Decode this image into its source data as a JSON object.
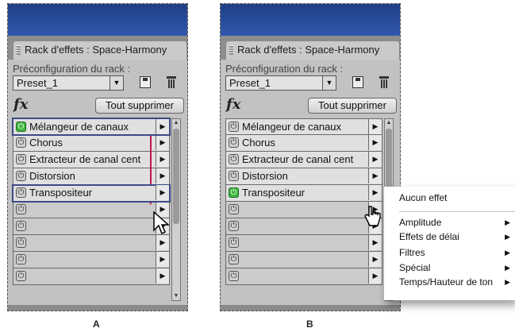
{
  "panels": [
    {
      "tab_title": "Rack d'effets : Space-Harmony",
      "preset_label": "Préconfiguration du rack :",
      "preset_value": "Preset_1",
      "fx_label": "fx",
      "remove_all_label": "Tout supprimer",
      "effects": [
        {
          "name": "Mélangeur de canaux",
          "on": true,
          "selected": true
        },
        {
          "name": "Chorus",
          "on": false
        },
        {
          "name": "Extracteur de canal cent",
          "on": false
        },
        {
          "name": "Distorsion",
          "on": false
        },
        {
          "name": "Transpositeur",
          "on": false,
          "selected": true
        },
        {
          "name": "",
          "on": false
        },
        {
          "name": "",
          "on": false
        },
        {
          "name": "",
          "on": false
        },
        {
          "name": "",
          "on": false
        },
        {
          "name": "",
          "on": false
        }
      ],
      "caption": "A"
    },
    {
      "tab_title": "Rack d'effets : Space-Harmony",
      "preset_label": "Préconfiguration du rack :",
      "preset_value": "Preset_1",
      "fx_label": "fx",
      "remove_all_label": "Tout supprimer",
      "effects": [
        {
          "name": "Mélangeur de canaux",
          "on": false
        },
        {
          "name": "Chorus",
          "on": false
        },
        {
          "name": "Extracteur de canal cent",
          "on": false
        },
        {
          "name": "Distorsion",
          "on": false
        },
        {
          "name": "Transpositeur",
          "on": true
        },
        {
          "name": "",
          "on": false
        },
        {
          "name": "",
          "on": false
        },
        {
          "name": "",
          "on": false
        },
        {
          "name": "",
          "on": false
        },
        {
          "name": "",
          "on": false
        }
      ],
      "caption": "B"
    }
  ],
  "context_menu": {
    "items": [
      {
        "label": "Aucun effet",
        "submenu": false
      },
      {
        "label": "Amplitude",
        "submenu": true
      },
      {
        "label": "Effets de délai",
        "submenu": true
      },
      {
        "label": "Filtres",
        "submenu": true
      },
      {
        "label": "Spécial",
        "submenu": true
      },
      {
        "label": "Temps/Hauteur de ton",
        "submenu": true
      }
    ]
  },
  "icons": {
    "power": "power-icon",
    "row_arrow": "triangle-right-icon",
    "save": "save-preset-icon",
    "delete": "trash-icon",
    "drag": "drag-arrow-icon",
    "cursor_a": "arrow-cursor-icon",
    "cursor_b": "hand-cursor-icon"
  },
  "colors": {
    "title_bar": "#2f58ad",
    "power_on": "#3fb53f",
    "drag_arrow": "#c0184a",
    "selection": "#3d4a86"
  }
}
